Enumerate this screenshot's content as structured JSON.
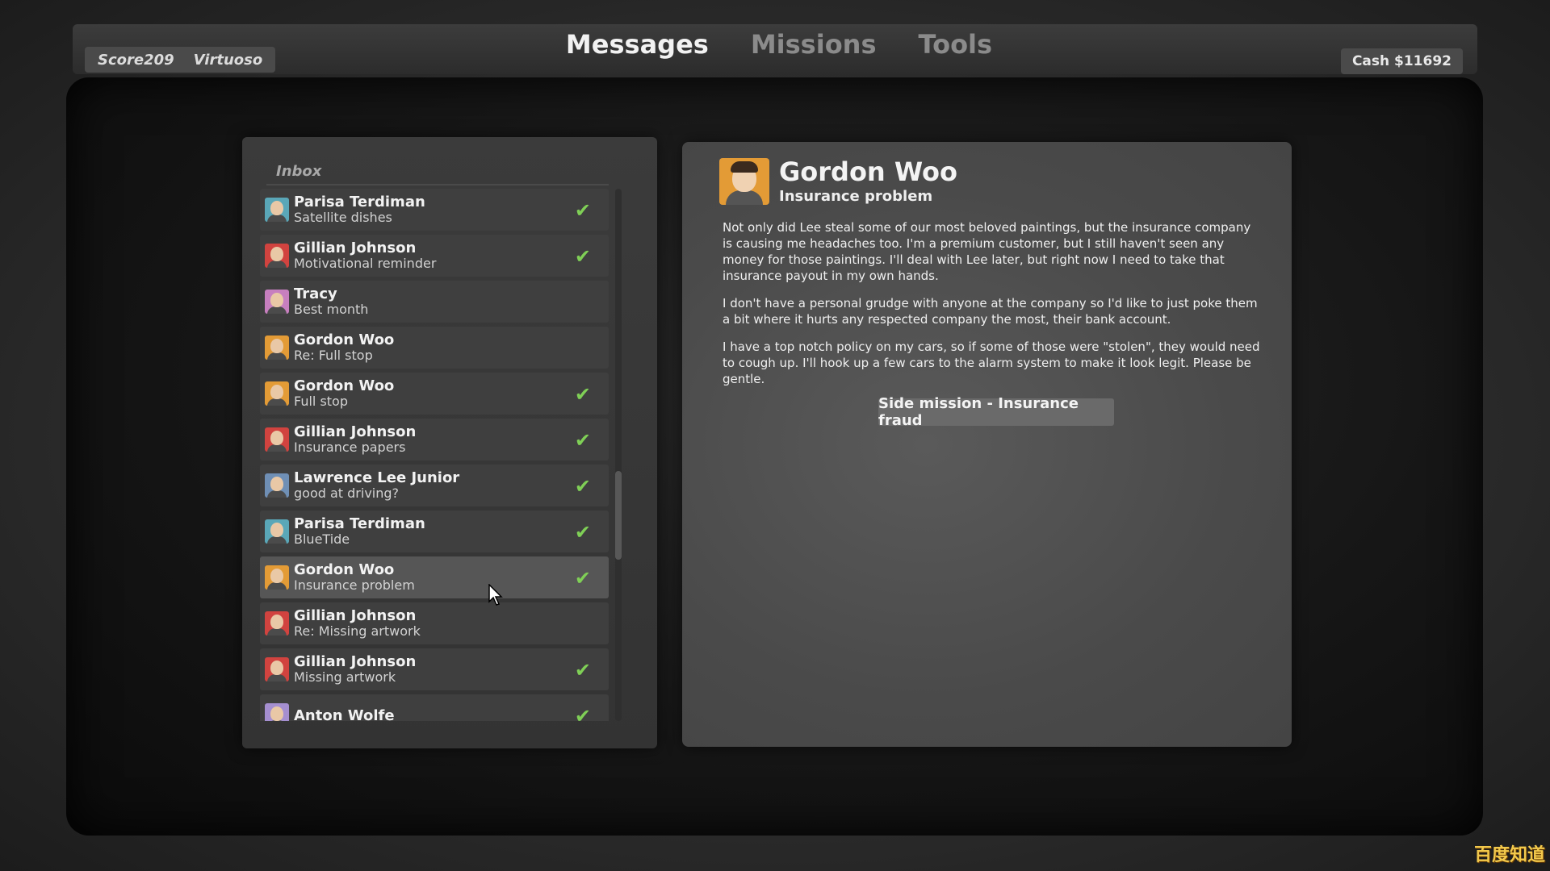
{
  "header": {
    "score": "Score209",
    "rank": "Virtuoso",
    "cash": "Cash $11692",
    "tabs": [
      {
        "label": "Messages",
        "active": true
      },
      {
        "label": "Missions",
        "active": false
      },
      {
        "label": "Tools",
        "active": false
      }
    ]
  },
  "inbox": {
    "title": "Inbox",
    "items": [
      {
        "name": "Parisa Terdiman",
        "subject": "Satellite dishes",
        "read": true,
        "color": "#5aa7b8"
      },
      {
        "name": "Gillian Johnson",
        "subject": "Motivational reminder",
        "read": true,
        "color": "#d1433f"
      },
      {
        "name": "Tracy",
        "subject": "Best month",
        "read": false,
        "color": "#c77fbf"
      },
      {
        "name": "Gordon Woo",
        "subject": "Re: Full stop",
        "read": false,
        "color": "#e39b36"
      },
      {
        "name": "Gordon Woo",
        "subject": "Full stop",
        "read": true,
        "color": "#e39b36"
      },
      {
        "name": "Gillian Johnson",
        "subject": "Insurance papers",
        "read": true,
        "color": "#d1433f"
      },
      {
        "name": "Lawrence Lee Junior",
        "subject": "good at driving?",
        "read": true,
        "color": "#6f8fb5"
      },
      {
        "name": "Parisa Terdiman",
        "subject": "BlueTide",
        "read": true,
        "color": "#5aa7b8"
      },
      {
        "name": "Gordon Woo",
        "subject": "Insurance problem",
        "read": true,
        "selected": true,
        "color": "#e39b36"
      },
      {
        "name": "Gillian Johnson",
        "subject": "Re: Missing artwork",
        "read": false,
        "color": "#d1433f"
      },
      {
        "name": "Gillian Johnson",
        "subject": "Missing artwork",
        "read": true,
        "color": "#d1433f"
      },
      {
        "name": "Anton Wolfe",
        "subject": "",
        "read": true,
        "color": "#a58fd0"
      }
    ]
  },
  "message": {
    "sender": "Gordon Woo",
    "subject": "Insurance problem",
    "paragraphs": [
      "Not only did Lee steal some of our most beloved paintings, but the insurance company is causing me headaches too. I'm a premium customer, but I still haven't seen any money for those paintings. I'll deal with Lee later, but right now I need to take that insurance payout in my own hands.",
      "I don't have a personal grudge with anyone at the company so I'd like to just poke them a bit where it hurts any respected company the most, their bank account.",
      "I have a top notch policy on my cars, so if some of those were \"stolen\", they would need to cough up. I'll hook up a few cars to the alarm system to make it look legit. Please be gentle."
    ],
    "action_label": "Side mission - Insurance fraud"
  },
  "check_glyph": "✔",
  "watermark": "百度知道"
}
